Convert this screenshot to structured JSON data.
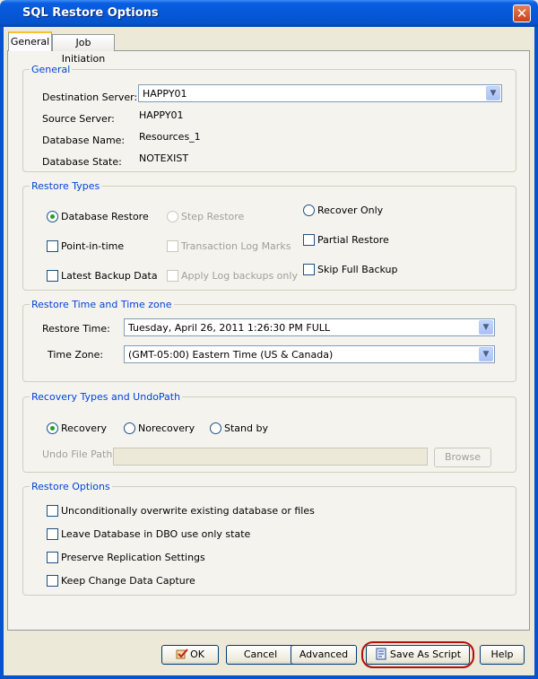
{
  "window": {
    "title": "SQL Restore Options",
    "close_glyph": "✕"
  },
  "tabs": [
    "General",
    "Job Initiation"
  ],
  "general": {
    "title": "General",
    "destination_server": {
      "label": "Destination Server:",
      "value": "HAPPY01"
    },
    "source_server": {
      "label": "Source Server:",
      "value": "HAPPY01"
    },
    "database_name": {
      "label": "Database Name:",
      "value": "Resources_1"
    },
    "database_state": {
      "label": "Database State:",
      "value": "NOTEXIST"
    }
  },
  "restore_types": {
    "title": "Restore Types",
    "database_restore": "Database Restore",
    "step_restore": "Step Restore",
    "recover_only": "Recover Only",
    "point_in_time": "Point-in-time",
    "transaction_log_marks": "Transaction Log Marks",
    "partial_restore": "Partial Restore",
    "latest_backup_data": "Latest Backup Data",
    "apply_log_backups_only": "Apply Log backups only",
    "skip_full_backup": "Skip Full Backup",
    "selected": "Database Restore"
  },
  "restore_time": {
    "title": "Restore Time and Time zone",
    "restore_time_label": "Restore Time:",
    "restore_time_value": "Tuesday, April 26, 2011 1:26:30 PM FULL",
    "time_zone_label": "Time Zone:",
    "time_zone_value": "(GMT-05:00) Eastern Time (US & Canada)"
  },
  "recovery": {
    "title": "Recovery Types and UndoPath",
    "recovery": "Recovery",
    "norecovery": "Norecovery",
    "standby": "Stand by",
    "selected": "Recovery",
    "undo_label": "Undo File Path:",
    "undo_value": "",
    "browse": "Browse"
  },
  "restore_options": {
    "title": "Restore Options",
    "items": [
      "Unconditionally overwrite existing database or files",
      "Leave Database in DBO use only state",
      "Preserve Replication Settings",
      "Keep Change Data Capture"
    ]
  },
  "buttons": {
    "ok": "OK",
    "cancel": "Cancel",
    "advanced": "Advanced",
    "save_as_script": "Save As Script",
    "help": "Help"
  },
  "icons": {
    "combo": "chevron-down-icon",
    "ok": "ok-icon",
    "script": "script-icon"
  },
  "colors": {
    "titlebar": "#0554cc",
    "group_title": "#0046d5",
    "radio_dot": "#21a121",
    "highlight": "#b50d0d"
  }
}
